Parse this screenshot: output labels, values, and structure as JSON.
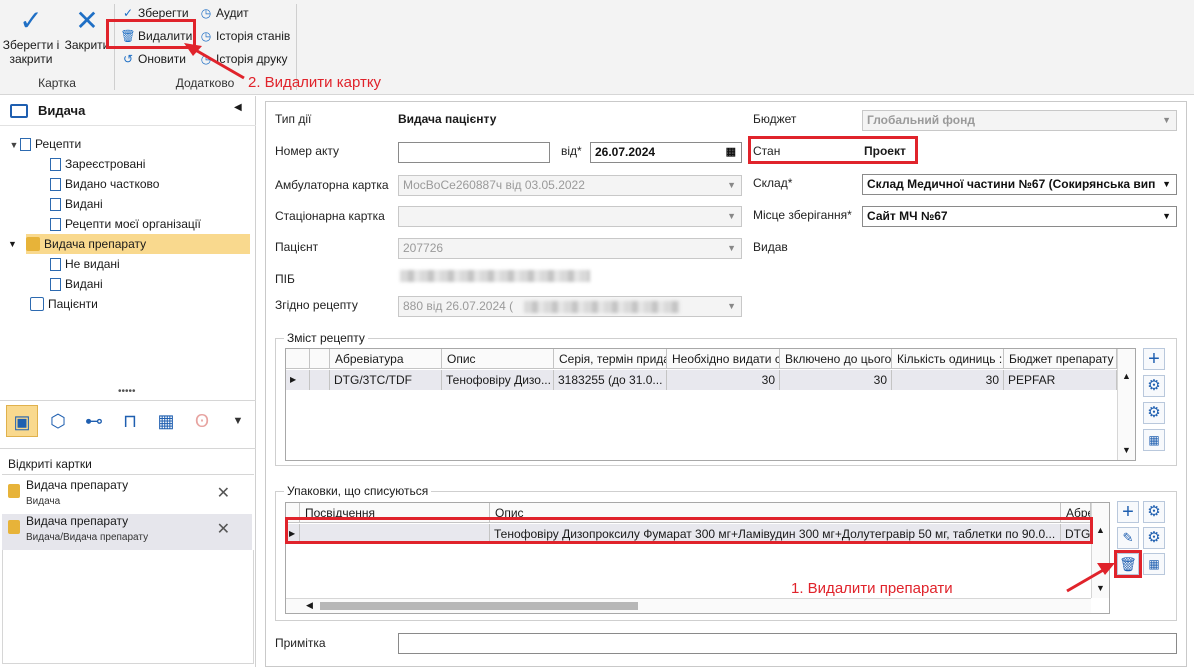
{
  "ribbon": {
    "save_close_label": "Зберегти і закрити",
    "close_label": "Закрити",
    "card_group": "Картка",
    "save_label": "Зберегти",
    "delete_label": "Видалити",
    "refresh_label": "Оновити",
    "audit_label": "Аудит",
    "state_history_label": "Історія станів",
    "print_history_label": "Історія друку",
    "extra_group": "Додатково"
  },
  "annotations": {
    "delete_card": "2. Видалити картку",
    "delete_drugs": "1. Видалити препарати",
    "color": "#e0232b"
  },
  "sidebar": {
    "title": "Видача",
    "tree": [
      {
        "label": "Рецепти"
      },
      {
        "label": "Зареєстровані"
      },
      {
        "label": "Видано частково"
      },
      {
        "label": "Видані"
      },
      {
        "label": "Рецепти моєї організації"
      },
      {
        "label": "Видача препарату"
      },
      {
        "label": "Не видані"
      },
      {
        "label": "Видані"
      },
      {
        "label": "Пацієнти"
      }
    ],
    "open_cards_title": "Відкриті картки",
    "open_cards": [
      {
        "title": "Видача препарату",
        "subtitle": "Видача"
      },
      {
        "title": "Видача препарату",
        "subtitle": "Видача/Видача препарату"
      }
    ]
  },
  "form": {
    "action_type_label": "Тип дії",
    "action_type_value": "Видача пацієнту",
    "act_number_label": "Номер акту",
    "act_number_value": "",
    "from_label": "від*",
    "date_value": "26.07.2024",
    "outpatient_card_label": "Амбулаторна картка",
    "outpatient_card_value": "МосВоСе260887ч від 03.05.2022",
    "inpatient_card_label": "Стаціонарна картка",
    "inpatient_card_value": "",
    "patient_label": "Пацієнт",
    "patient_value": "207726",
    "pib_label": "ПІБ",
    "prescription_label": "Згідно рецепту",
    "prescription_value": "880 від 26.07.2024 (",
    "budget_label": "Бюджет",
    "budget_value": "Глобальний фонд",
    "state_label": "Стан",
    "state_value": "Проект",
    "warehouse_label": "Склад*",
    "warehouse_value": "Склад Медичної частини №67 (Сокирянська вип",
    "storage_label": "Місце зберігання*",
    "storage_value": "Сайт МЧ №67",
    "issued_label": "Видав",
    "note_label": "Примітка",
    "note_value": ""
  },
  "recipe_grid": {
    "title": "Зміст рецепту",
    "columns": [
      "Абревіатура",
      "Опис",
      "Серія, термін прида",
      "Необхідно видати с",
      "Включено до цього",
      "Кількість одиниць :",
      "Бюджет препарату"
    ],
    "rows": [
      [
        "DTG/3TC/TDF",
        "Тенофовіру Дизо...",
        "3183255 (до 31.0...",
        "30",
        "30",
        "30",
        "PEPFAR"
      ]
    ]
  },
  "packages_grid": {
    "title": "Упаковки, що списуються",
    "columns": [
      "Посвідчення",
      "Опис",
      "Абре"
    ],
    "rows": [
      [
        "",
        "Тенофовіру Дизопроксилу Фумарат 300 мг+Ламівудин 300 мг+Долутегравір 50 мг, таблетки по 90.0...",
        "DTG/"
      ]
    ]
  }
}
